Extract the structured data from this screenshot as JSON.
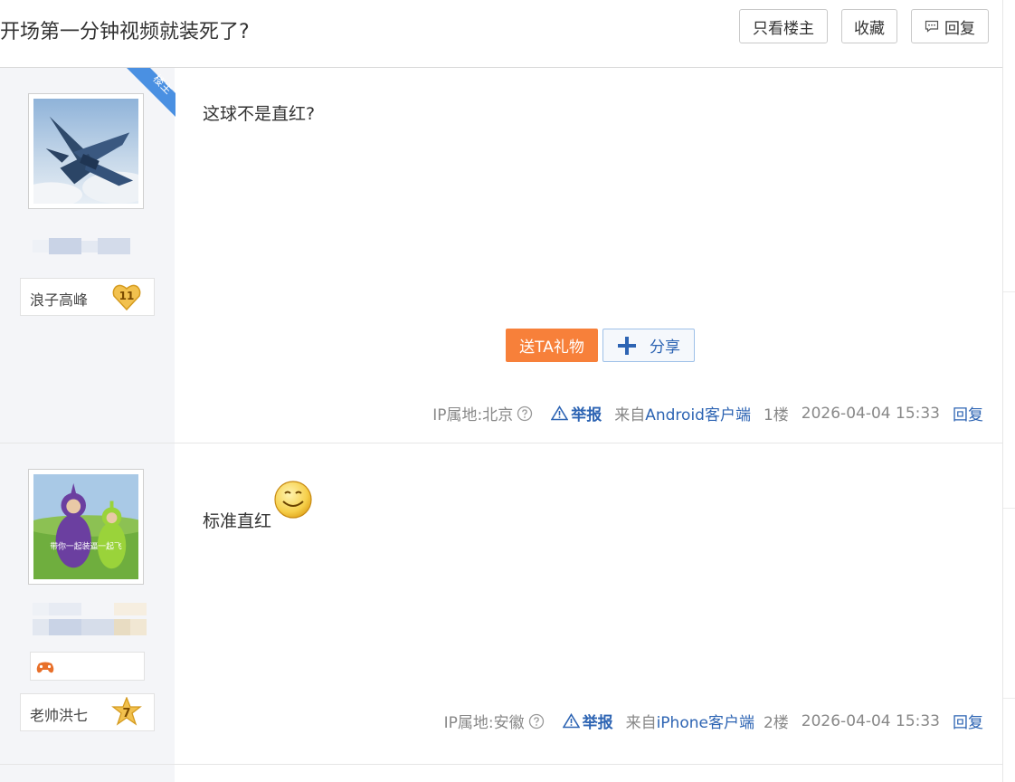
{
  "thread": {
    "title": "开场第一分钟视频就装死了?",
    "buttons": {
      "only_op": "只看楼主",
      "favorite": "收藏",
      "reply": "回复"
    }
  },
  "posts": [
    {
      "badge": "楼主",
      "user": {
        "level_name": "浪子高峰",
        "level_num": "11"
      },
      "content": "这球不是直红?",
      "actions": {
        "gift": "送TA礼物",
        "share": "分享"
      },
      "tail": {
        "ip": "IP属地:北京",
        "report": "举报",
        "from_prefix": "来自",
        "client": "Android客户端",
        "floor": "1楼",
        "time": "2026-04-04 15:33",
        "reply": "回复"
      }
    },
    {
      "user": {
        "level_name": "老帅洪七",
        "level_num": "7",
        "avatar_caption": "带你一起装逼一起飞"
      },
      "content": "标准直红",
      "tail": {
        "ip": "IP属地:安徽",
        "report": "举报",
        "from_prefix": "来自",
        "client": "iPhone客户端",
        "floor": "2楼",
        "time": "2026-04-04 15:33",
        "reply": "回复"
      }
    }
  ],
  "colors": {
    "accent_blue": "#2d64b3",
    "gift_orange": "#f7803a",
    "badge_blue": "#4a90e2"
  }
}
